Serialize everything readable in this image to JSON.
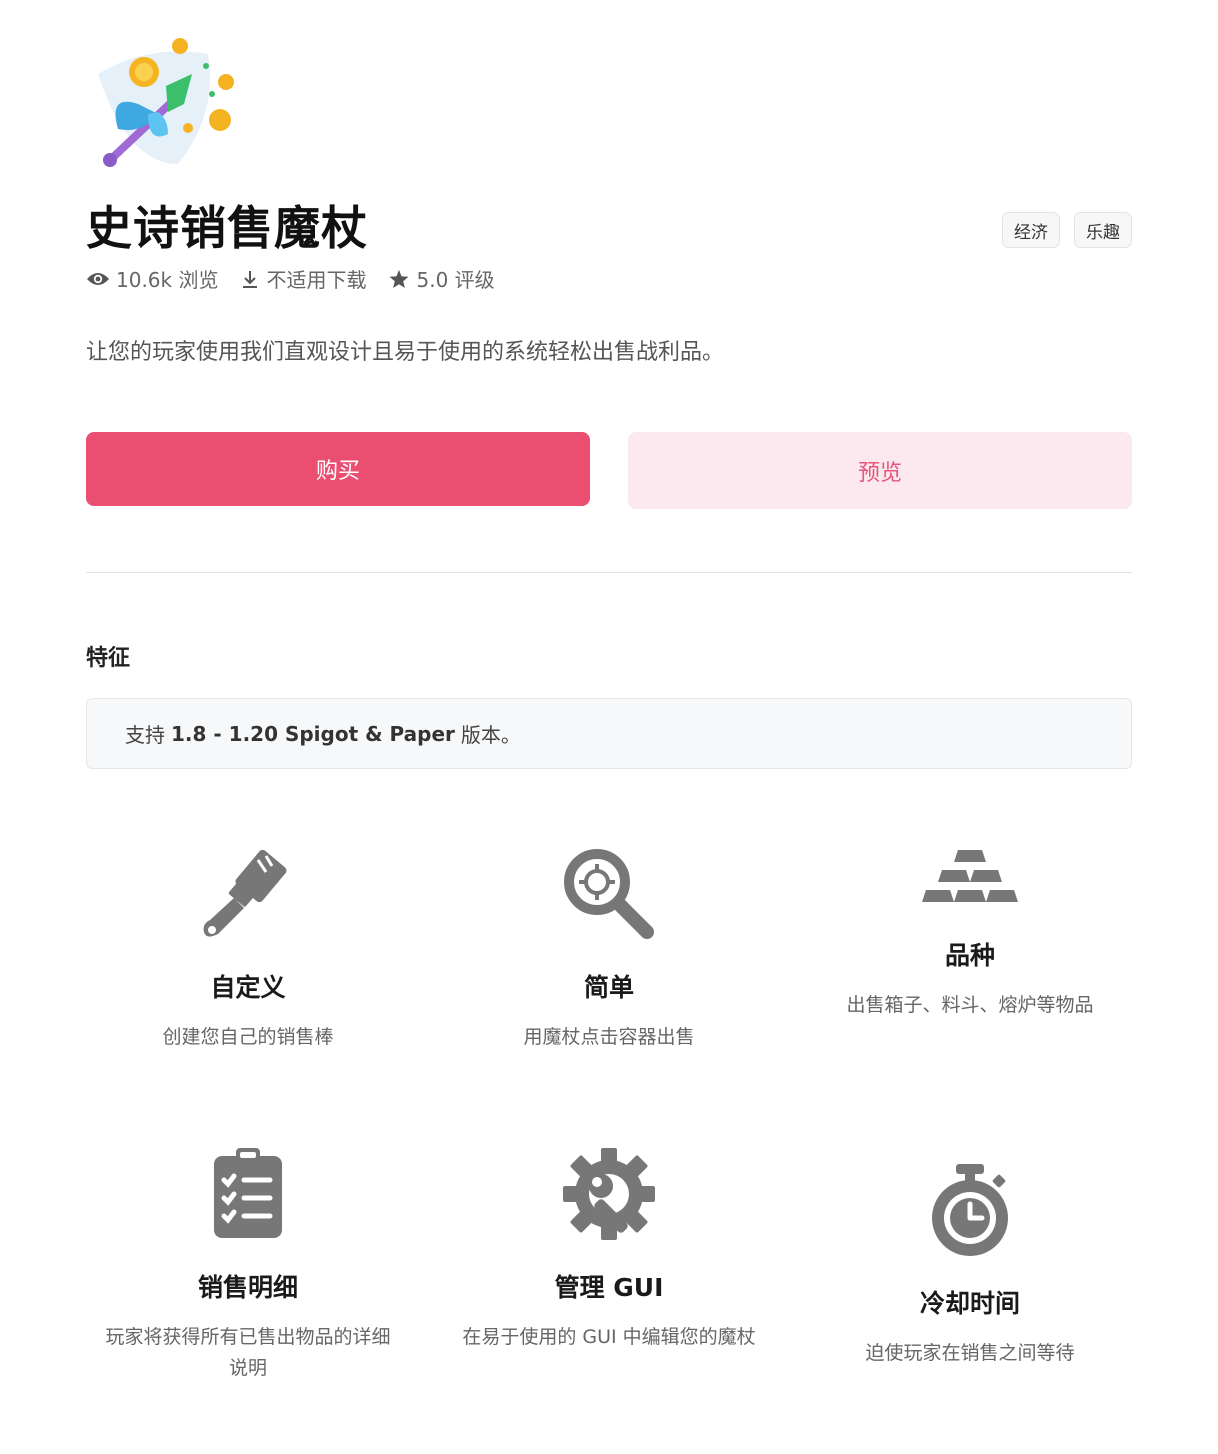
{
  "product": {
    "title": "史诗销售魔杖",
    "tags": [
      "经济",
      "乐趣"
    ],
    "views": "10.6k 浏览",
    "downloads": "不适用下载",
    "rating": "5.0 评级",
    "description": "让您的玩家使用我们直观设计且易于使用的系统轻松出售战利品。"
  },
  "actions": {
    "buy_label": "购买",
    "preview_label": "预览"
  },
  "features_section": {
    "title": "特征",
    "notice_prefix": "支持",
    "notice_versions": "1.8 - 1.20 Spigot & Paper",
    "notice_suffix": "版本。",
    "items": [
      {
        "icon": "paintbrush-icon",
        "name": "自定义",
        "desc": "创建您自己的销售棒"
      },
      {
        "icon": "magnifier-target-icon",
        "name": "简单",
        "desc": "用魔杖点击容器出售"
      },
      {
        "icon": "gold-bars-icon",
        "name": "品种",
        "desc": "出售箱子、料斗、熔炉等物品"
      },
      {
        "icon": "clipboard-checklist-icon",
        "name": "销售明细",
        "desc": "玩家将获得所有已售出物品的详细说明"
      },
      {
        "icon": "gear-wrench-icon",
        "name": "管理 GUI",
        "desc": "在易于使用的 GUI 中编辑您的魔杖"
      },
      {
        "icon": "stopwatch-icon",
        "name": "冷却时间",
        "desc": "迫使玩家在销售之间等待"
      }
    ]
  },
  "colors": {
    "primary": "#ea4f72",
    "preview_bg": "#fbe9ef",
    "icon_gray": "#7a7a7a"
  }
}
